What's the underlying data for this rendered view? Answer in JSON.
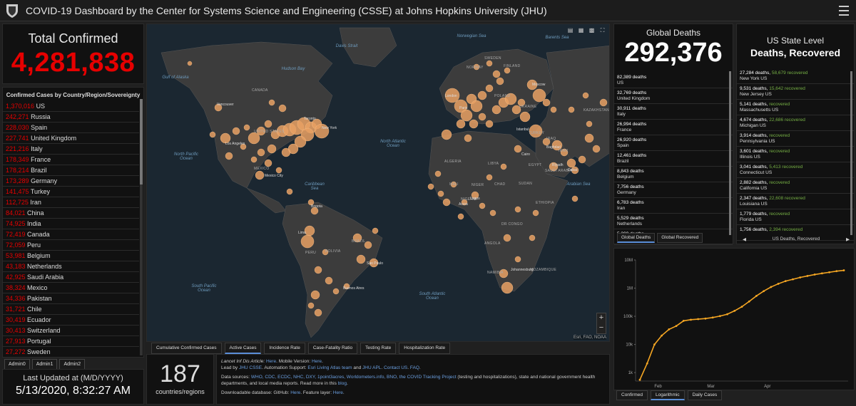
{
  "header": {
    "title": "COVID-19 Dashboard by the Center for Systems Science and Engineering (CSSE) at Johns Hopkins University (JHU)"
  },
  "total": {
    "label": "Total Confirmed",
    "value": "4,281,838"
  },
  "country_list": {
    "title": "Confirmed Cases by Country/Region/Sovereignty",
    "items": [
      {
        "n": "1,370,016",
        "name": "US"
      },
      {
        "n": "242,271",
        "name": "Russia"
      },
      {
        "n": "228,030",
        "name": "Spain"
      },
      {
        "n": "227,741",
        "name": "United Kingdom"
      },
      {
        "n": "221,216",
        "name": "Italy"
      },
      {
        "n": "178,349",
        "name": "France"
      },
      {
        "n": "178,214",
        "name": "Brazil"
      },
      {
        "n": "173,289",
        "name": "Germany"
      },
      {
        "n": "141,475",
        "name": "Turkey"
      },
      {
        "n": "112,725",
        "name": "Iran"
      },
      {
        "n": "84,021",
        "name": "China"
      },
      {
        "n": "74,925",
        "name": "India"
      },
      {
        "n": "72,419",
        "name": "Canada"
      },
      {
        "n": "72,059",
        "name": "Peru"
      },
      {
        "n": "53,981",
        "name": "Belgium"
      },
      {
        "n": "43,183",
        "name": "Netherlands"
      },
      {
        "n": "42,925",
        "name": "Saudi Arabia"
      },
      {
        "n": "38,324",
        "name": "Mexico"
      },
      {
        "n": "34,336",
        "name": "Pakistan"
      },
      {
        "n": "31,721",
        "name": "Chile"
      },
      {
        "n": "30,419",
        "name": "Ecuador"
      },
      {
        "n": "30,413",
        "name": "Switzerland"
      },
      {
        "n": "27,913",
        "name": "Portugal"
      },
      {
        "n": "27,272",
        "name": "Sweden"
      }
    ]
  },
  "admin_tabs": [
    "Admin0",
    "Admin1",
    "Admin2"
  ],
  "updated": {
    "label": "Last Updated at (M/D/YYYY)",
    "value": "5/13/2020, 8:32:27 AM"
  },
  "map": {
    "attribution": "Esri, FAO, NOAA",
    "labels": [
      "CANADA",
      "UNITED STATES",
      "BRAZIL",
      "PERU",
      "BOLIVIA",
      "ALGERIA",
      "LIBYA",
      "EGYPT",
      "NIGER",
      "NIGERIA",
      "ETHIOPIA",
      "ANGOLA",
      "MALI",
      "CHAD",
      "SUDAN",
      "DR CONGO",
      "NAMIBIA",
      "MOZAMBIQUE",
      "SWEDEN",
      "NORWAY",
      "KAZAKHSTAN",
      "IRAN",
      "SAUDI ARABIA",
      "POLAND",
      "UKRAINE",
      "TURKEY",
      "IRAQ",
      "FINLAND",
      "MEXICO"
    ],
    "oceans": [
      "North Pacific Ocean",
      "North Atlantic Ocean",
      "South Pacific Ocean",
      "South Atlantic Ocean",
      "Norwegian Sea",
      "Gulf of Alaska",
      "Hudson Bay",
      "Davis Strait",
      "Caribbean Sea",
      "Arabian Sea",
      "Barents Sea"
    ],
    "cities": [
      "Vancouver",
      "Los Angeles",
      "Mexico City",
      "Toronto",
      "New York",
      "Bogota",
      "Lima",
      "Sao Paulo",
      "Buenos Aires",
      "Lagos",
      "Accra",
      "Johannesburg",
      "Moscow",
      "Baghdad",
      "Cairo",
      "Riyadh",
      "Dubai",
      "Istanbul",
      "Paris",
      "London"
    ],
    "zoom_in": "+",
    "zoom_out": "−"
  },
  "map_tabs": [
    "Cumulative Confirmed Cases",
    "Active Cases",
    "Incidence Rate",
    "Case-Fatality Ratio",
    "Testing Rate",
    "Hospitalization Rate"
  ],
  "countries": {
    "value": "187",
    "label": "countries/regions"
  },
  "info": {
    "line1_a": "Lancet Inf Dis Article: ",
    "line1_b": "Here",
    "line1_c": ". Mobile Version: ",
    "line1_d": "Here",
    "line2_a": "Lead by ",
    "line2_b": "JHU CSSE",
    "line2_c": ". Automation Support: ",
    "line2_d": "Esri Living Atlas team",
    "line2_e": " and ",
    "line2_f": "JHU APL",
    "line2_g": ". ",
    "line2_h": "Contact US",
    "line2_i": ". ",
    "line2_j": "FAQ",
    "line3_a": "Data sources: ",
    "line3_b": "WHO, CDC, ECDC, NHC, DXY, 1point3acres, Worldometers.info, BNO, the COVID Tracking Project",
    "line3_c": " (testing and hospitalizations), state and national government health departments, and local media reports.  Read more in this ",
    "line3_d": "blog",
    "line4_a": "Downloadable database: GitHub: ",
    "line4_b": "Here",
    "line4_c": ". Feature layer: ",
    "line4_d": "Here"
  },
  "global_deaths": {
    "label": "Global Deaths",
    "value": "292,376",
    "items": [
      {
        "d": "82,389 deaths",
        "c": "US"
      },
      {
        "d": "32,769 deaths",
        "c": "United Kingdom"
      },
      {
        "d": "30,911 deaths",
        "c": "Italy"
      },
      {
        "d": "26,994 deaths",
        "c": "France"
      },
      {
        "d": "26,920 deaths",
        "c": "Spain"
      },
      {
        "d": "12,461 deaths",
        "c": "Brazil"
      },
      {
        "d": "8,843 deaths",
        "c": "Belgium"
      },
      {
        "d": "7,756 deaths",
        "c": "Germany"
      },
      {
        "d": "6,783 deaths",
        "c": "Iran"
      },
      {
        "d": "5,529 deaths",
        "c": "Netherlands"
      },
      {
        "d": "5,300 deaths",
        "c": ""
      }
    ],
    "tabs": [
      "Global Deaths",
      "Global Recovered"
    ]
  },
  "us_state": {
    "label": "US State Level",
    "label2": "Deaths, Recovered",
    "items": [
      {
        "d": "27,284 deaths,",
        "r": "58,679 recovered",
        "s": "New York US"
      },
      {
        "d": "9,531 deaths,",
        "r": "15,642 recovered",
        "s": "New Jersey US"
      },
      {
        "d": "5,141 deaths,",
        "r": "recovered",
        "s": "Massachusetts US"
      },
      {
        "d": "4,674 deaths,",
        "r": "22,686 recovered",
        "s": "Michigan US"
      },
      {
        "d": "3,914 deaths,",
        "r": "recovered",
        "s": "Pennsylvania US"
      },
      {
        "d": "3,601 deaths,",
        "r": "recovered",
        "s": "Illinois US"
      },
      {
        "d": "3,041 deaths,",
        "r": "5,413 recovered",
        "s": "Connecticut US"
      },
      {
        "d": "2,882 deaths,",
        "r": "recovered",
        "s": "California US"
      },
      {
        "d": "2,347 deaths,",
        "r": "22,608 recovered",
        "s": "Louisiana US"
      },
      {
        "d": "1,779 deaths,",
        "r": "recovered",
        "s": "Florida US"
      },
      {
        "d": "1,756 deaths,",
        "r": "2,394 recovered",
        "s": ""
      }
    ],
    "nav_label": "US Deaths, Recovered",
    "nav_left": "◀",
    "nav_right": "▶"
  },
  "chart_data": {
    "type": "line",
    "title": "",
    "xlabel": "",
    "ylabel": "",
    "y_scale": "log",
    "yticks": [
      "1k",
      "10k",
      "100k",
      "1M",
      "10M"
    ],
    "xticks": [
      "Feb",
      "Mar",
      "Apr"
    ],
    "x": [
      "1/22",
      "1/26",
      "1/30",
      "2/3",
      "2/7",
      "2/11",
      "2/15",
      "2/19",
      "2/23",
      "2/27",
      "3/2",
      "3/6",
      "3/10",
      "3/14",
      "3/18",
      "3/22",
      "3/26",
      "3/30",
      "4/3",
      "4/7",
      "4/11",
      "4/15",
      "4/19",
      "4/23",
      "4/27",
      "5/1",
      "5/5",
      "5/9",
      "5/13"
    ],
    "values": [
      555,
      2118,
      9927,
      20630,
      34391,
      45221,
      69032,
      75641,
      79356,
      83112,
      90306,
      101800,
      118592,
      156101,
      218744,
      336004,
      529591,
      782365,
      1095917,
      1426096,
      1777666,
      2056055,
      2401378,
      2708885,
      3041764,
      3343777,
      3662691,
      4013685,
      4281838
    ],
    "color": "#f5a623",
    "grid": false
  },
  "chart_tabs": [
    "Confirmed",
    "Logarithmic",
    "Daily Cases"
  ]
}
